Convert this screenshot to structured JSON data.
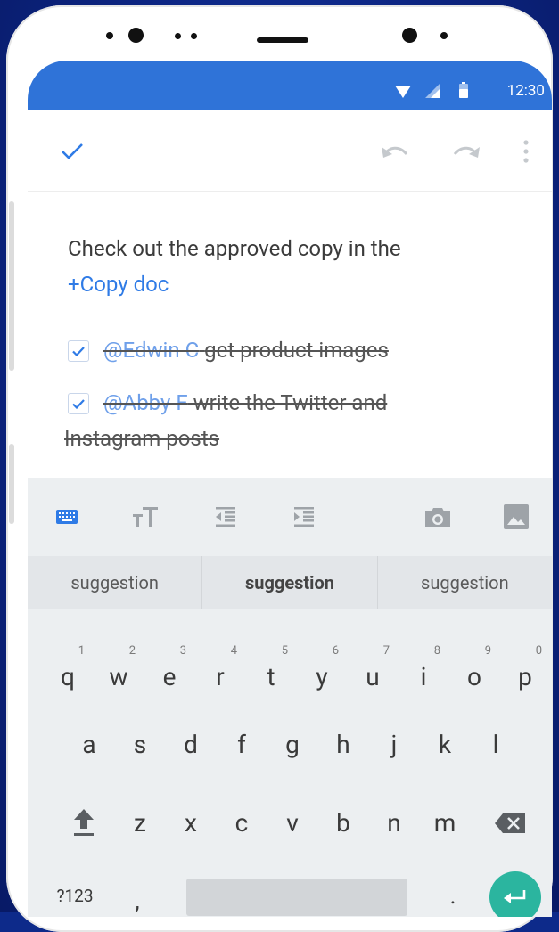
{
  "status_bar": {
    "time": "12:30"
  },
  "app_bar": {
    "done_icon": "check-icon",
    "undo_icon": "undo-icon",
    "redo_icon": "redo-icon",
    "more_icon": "more-vert-icon"
  },
  "note": {
    "text": "Check out the approved copy in the",
    "link": "+Copy doc",
    "tasks": [
      {
        "checked": true,
        "mention": "@Edwin C",
        "text": "get product images"
      },
      {
        "checked": true,
        "mention": "@Abby F",
        "text": "write the Twitter and",
        "text_cont": "Instagram posts"
      }
    ]
  },
  "keyboard": {
    "toolbar_icons": [
      "keyboard-icon",
      "text-size-icon",
      "outdent-icon",
      "indent-icon",
      "camera-icon",
      "image-icon"
    ],
    "suggestions": [
      "suggestion",
      "suggestion",
      "suggestion"
    ],
    "row1": [
      "q",
      "w",
      "e",
      "r",
      "t",
      "y",
      "u",
      "i",
      "o",
      "p"
    ],
    "row1_hints": [
      "1",
      "2",
      "3",
      "4",
      "5",
      "6",
      "7",
      "8",
      "9",
      "0"
    ],
    "row2": [
      "a",
      "s",
      "d",
      "f",
      "g",
      "h",
      "j",
      "k",
      "l"
    ],
    "row3": [
      "z",
      "x",
      "c",
      "v",
      "b",
      "n",
      "m"
    ],
    "symbols_key": "?123",
    "comma_key": ",",
    "period_key": "."
  },
  "colors": {
    "background": "#0d2a8a",
    "status_bar": "#2f73d8",
    "accent": "#2f7be6",
    "enter_key": "#2bb59f"
  }
}
